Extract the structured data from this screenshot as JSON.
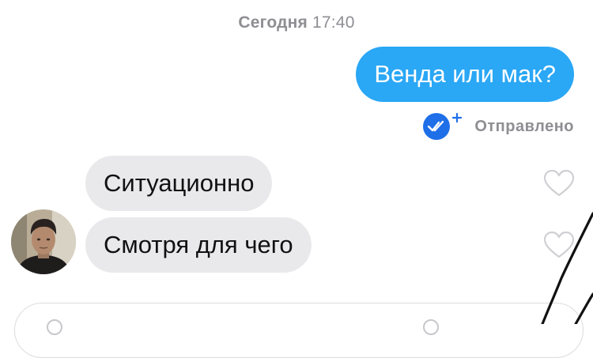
{
  "timestamp": {
    "day": "Сегодня",
    "time": "17:40"
  },
  "messages": {
    "outgoing": {
      "text": "Венда или мак?",
      "status": "Отправлено"
    },
    "incoming": [
      {
        "text": "Ситуационно"
      },
      {
        "text": "Смотря для чего"
      }
    ]
  },
  "icons": {
    "status": "double-check-plus-icon",
    "like": "heart-outline-icon"
  },
  "colors": {
    "outgoing_bubble": "#2aa7f5",
    "incoming_bubble": "#e9e9eb",
    "status_icon": "#1e6fe8",
    "meta_text": "#8e8e93"
  }
}
